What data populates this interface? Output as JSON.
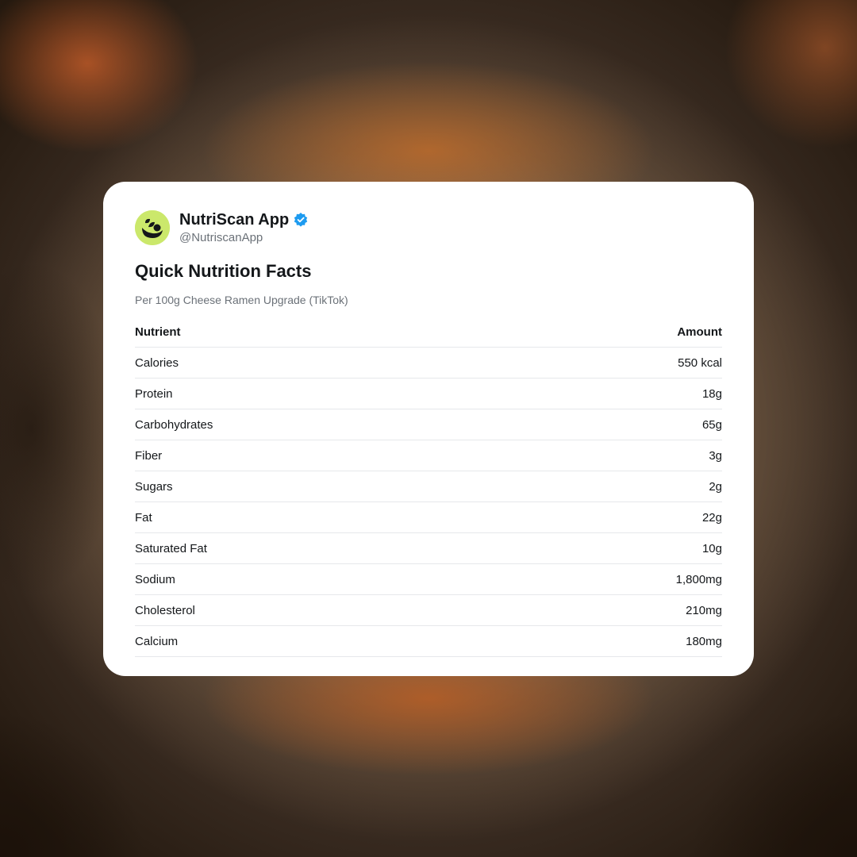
{
  "profile": {
    "name": "NutriScan App",
    "handle": "@NutriscanApp",
    "avatar_icon": "nutriscan-logo-icon",
    "verified_icon": "verified-badge-icon"
  },
  "card": {
    "title": "Quick Nutrition Facts",
    "subtitle": "Per 100g Cheese Ramen Upgrade (TikTok)"
  },
  "table": {
    "headers": [
      "Nutrient",
      "Amount"
    ],
    "rows": [
      {
        "nutrient": "Calories",
        "amount": "550 kcal"
      },
      {
        "nutrient": "Protein",
        "amount": "18g"
      },
      {
        "nutrient": "Carbohydrates",
        "amount": "65g"
      },
      {
        "nutrient": "Fiber",
        "amount": "3g"
      },
      {
        "nutrient": "Sugars",
        "amount": "2g"
      },
      {
        "nutrient": "Fat",
        "amount": "22g"
      },
      {
        "nutrient": "Saturated Fat",
        "amount": "10g"
      },
      {
        "nutrient": "Sodium",
        "amount": "1,800mg"
      },
      {
        "nutrient": "Cholesterol",
        "amount": "210mg"
      },
      {
        "nutrient": "Calcium",
        "amount": "180mg"
      }
    ]
  },
  "colors": {
    "avatar_bg": "#cbe86b",
    "verified": "#1d9bf0",
    "text_primary": "#14171a",
    "text_secondary": "#6b7178"
  }
}
